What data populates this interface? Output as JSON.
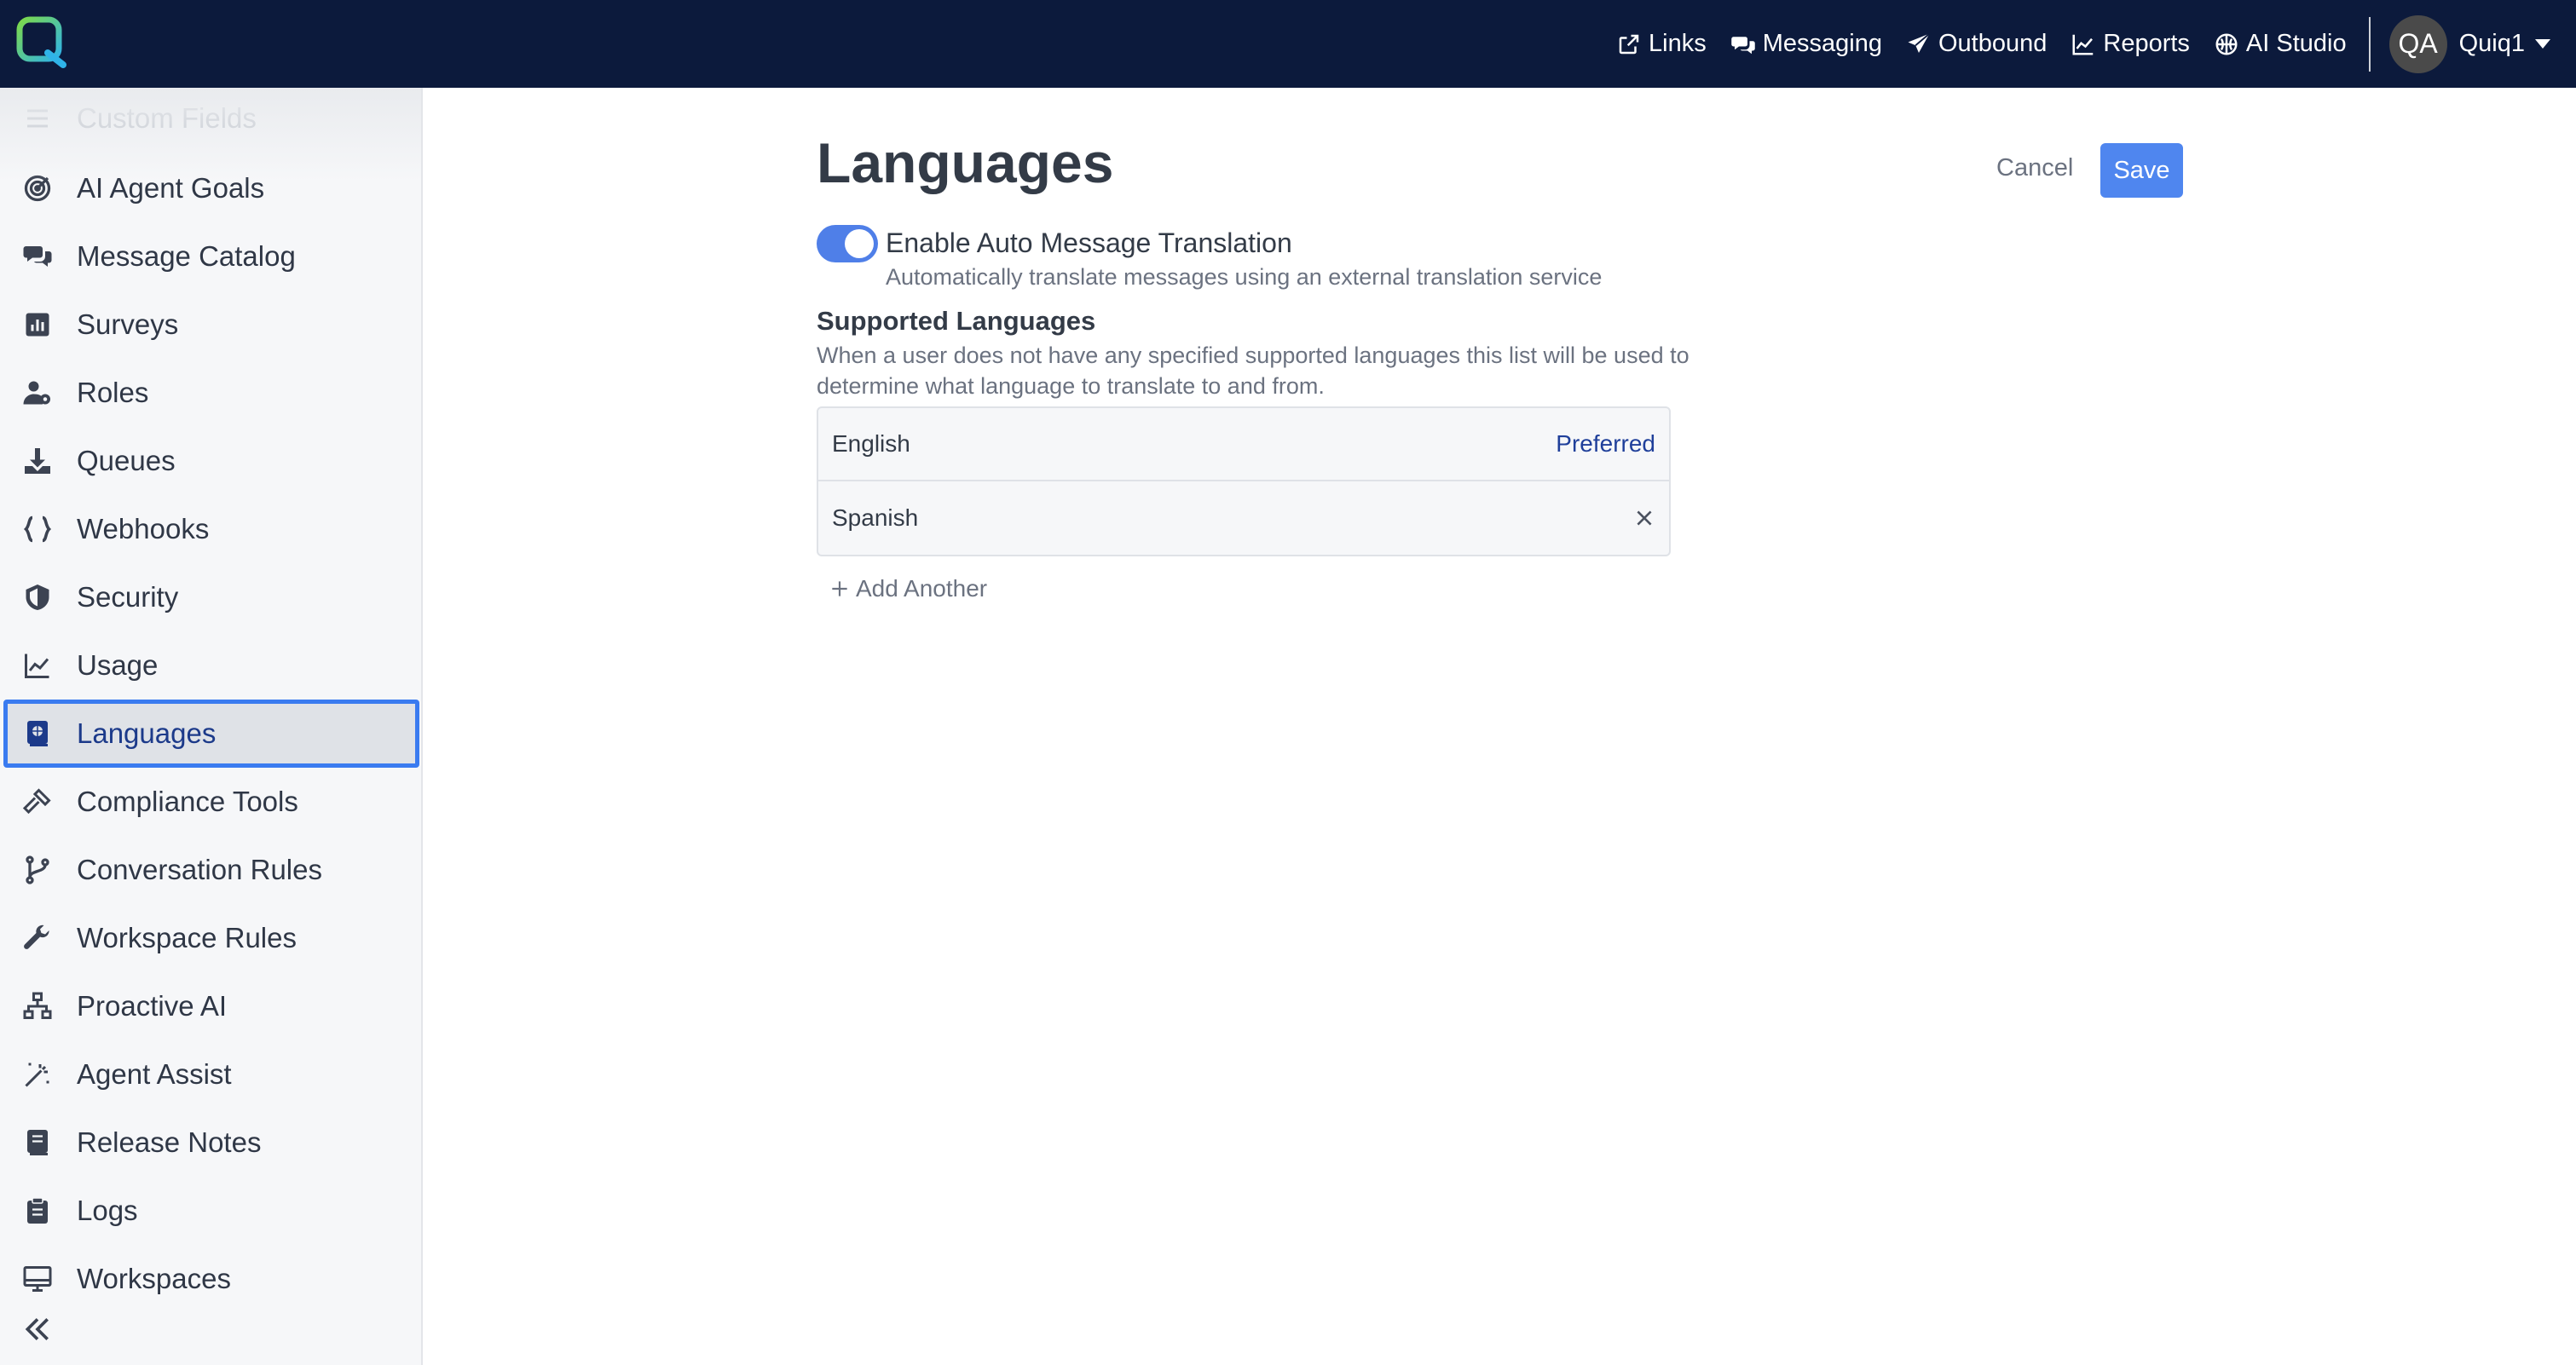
{
  "nav": {
    "links": "Links",
    "messaging": "Messaging",
    "outbound": "Outbound",
    "reports": "Reports",
    "ai_studio": "AI Studio",
    "avatar_initials": "QA",
    "user": "Quiq1"
  },
  "sidebar": {
    "items": [
      {
        "label": "Custom Fields",
        "icon": "list-icon"
      },
      {
        "label": "AI Agent Goals",
        "icon": "target-icon"
      },
      {
        "label": "Message Catalog",
        "icon": "comments-icon"
      },
      {
        "label": "Surveys",
        "icon": "chart-bar-icon"
      },
      {
        "label": "Roles",
        "icon": "user-gear-icon"
      },
      {
        "label": "Queues",
        "icon": "download-icon"
      },
      {
        "label": "Webhooks",
        "icon": "braces-icon"
      },
      {
        "label": "Security",
        "icon": "shield-icon"
      },
      {
        "label": "Usage",
        "icon": "line-chart-icon"
      },
      {
        "label": "Languages",
        "icon": "language-book-icon"
      },
      {
        "label": "Compliance Tools",
        "icon": "gavel-icon"
      },
      {
        "label": "Conversation Rules",
        "icon": "branch-icon"
      },
      {
        "label": "Workspace Rules",
        "icon": "wrench-icon"
      },
      {
        "label": "Proactive AI",
        "icon": "sitemap-icon"
      },
      {
        "label": "Agent Assist",
        "icon": "magic-wand-icon"
      },
      {
        "label": "Release Notes",
        "icon": "book-icon"
      },
      {
        "label": "Logs",
        "icon": "clipboard-icon"
      },
      {
        "label": "Workspaces",
        "icon": "monitor-icon"
      }
    ]
  },
  "page": {
    "title": "Languages",
    "cancel": "Cancel",
    "save": "Save",
    "toggle_label": "Enable Auto Message Translation",
    "toggle_help": "Automatically translate messages using an external translation service",
    "toggle_on": true,
    "section_title": "Supported Languages",
    "section_desc": "When a user does not have any specified supported languages this list will be used to determine what language to translate to and from.",
    "languages": [
      {
        "name": "English",
        "tag": "Preferred"
      },
      {
        "name": "Spanish",
        "tag": ""
      }
    ],
    "add_another": "Add Another"
  },
  "colors": {
    "topbar": "#0c1a3c",
    "accent": "#4f86ef",
    "active_border": "#3a7bf0"
  }
}
